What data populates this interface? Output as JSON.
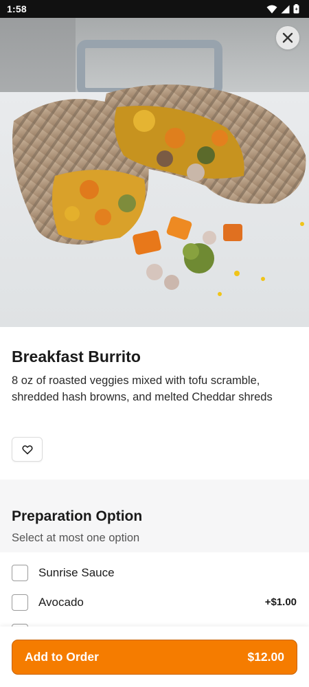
{
  "status_bar": {
    "time": "1:58",
    "icons": [
      "wifi-icon",
      "signal-icon",
      "battery-icon"
    ]
  },
  "header": {
    "close_icon": "close-icon"
  },
  "item": {
    "title": "Breakfast Burrito",
    "description": "8 oz of roasted veggies mixed with tofu scramble, shredded hash browns, and melted Cheddar shreds",
    "favorite_icon": "heart-icon"
  },
  "preparation": {
    "title": "Preparation Option",
    "subtitle": "Select at most one option",
    "options": [
      {
        "label": "Sunrise Sauce",
        "price": "",
        "checked": false
      },
      {
        "label": "Avocado",
        "price": "+$1.00",
        "checked": false
      }
    ]
  },
  "footer": {
    "add_label": "Add to Order",
    "total": "$12.00"
  },
  "colors": {
    "accent": "#f57c00",
    "accent_border": "#c86200",
    "section_bg": "#f6f6f7"
  }
}
